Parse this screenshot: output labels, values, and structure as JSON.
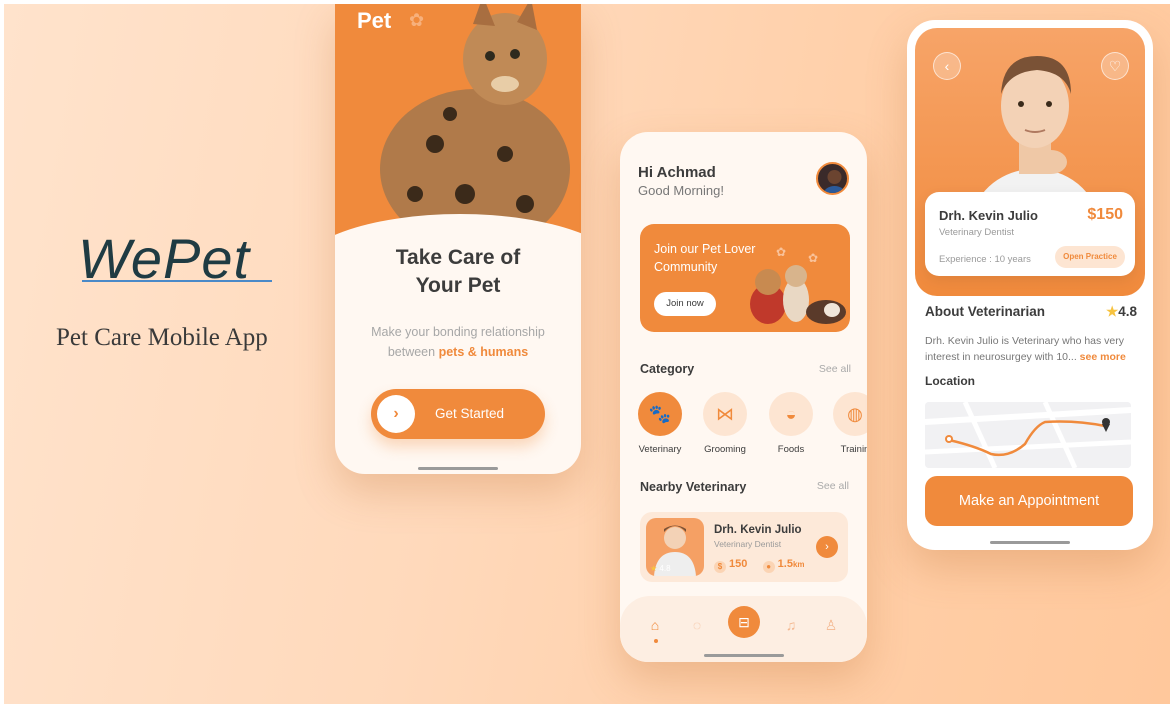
{
  "branding": {
    "logo": "WePet",
    "subtitle": "Pet Care Mobile App"
  },
  "onboarding": {
    "logo": "Pet",
    "title_line1": "Take Care of",
    "title_line2": "Your Pet",
    "desc_line1": "Make your bonding relationship",
    "desc_prefix": "between ",
    "desc_highlight": "pets & humans",
    "button_label": "Get Started",
    "button_icon": "chevron-right-icon"
  },
  "home": {
    "greeting": "Hi Achmad",
    "subgreeting": "Good Morning!",
    "banner": {
      "text": "Join our Pet Lover Community",
      "button_label": "Join now"
    },
    "category": {
      "title": "Category",
      "see_all": "See all",
      "items": [
        {
          "label": "Veterinary",
          "icon": "paw-icon",
          "active": true
        },
        {
          "label": "Grooming",
          "icon": "bow-icon",
          "active": false
        },
        {
          "label": "Foods",
          "icon": "food-bowl-icon",
          "active": false
        },
        {
          "label": "Trainin",
          "icon": "ball-icon",
          "active": false
        }
      ]
    },
    "nearby": {
      "title": "Nearby Veterinary",
      "see_all": "See all",
      "card": {
        "rating": "4.8",
        "name": "Drh. Kevin Julio",
        "role": "Veterinary Dentist",
        "price": "150",
        "distance": "1.5",
        "distance_unit": "km"
      }
    },
    "tabs": [
      "home-icon",
      "chat-icon",
      "shop-icon",
      "bell-icon",
      "profile-icon"
    ]
  },
  "detail": {
    "name": "Drh. Kevin Julio",
    "price": "$150",
    "role": "Veterinary Dentist",
    "experience": "Experience : 10 years",
    "open_label": "Open Practice",
    "about_title": "About Veterinarian",
    "rating": "4.8",
    "about_text": "Drh. Kevin Julio is Veterinary who has very interest in neurosurgey with 10... ",
    "see_more": "see more",
    "location_title": "Location",
    "cta": "Make an Appointment"
  },
  "colors": {
    "accent": "#f08a3c",
    "accent_light": "#fde5d2",
    "text_dark": "#3c3c3c"
  }
}
